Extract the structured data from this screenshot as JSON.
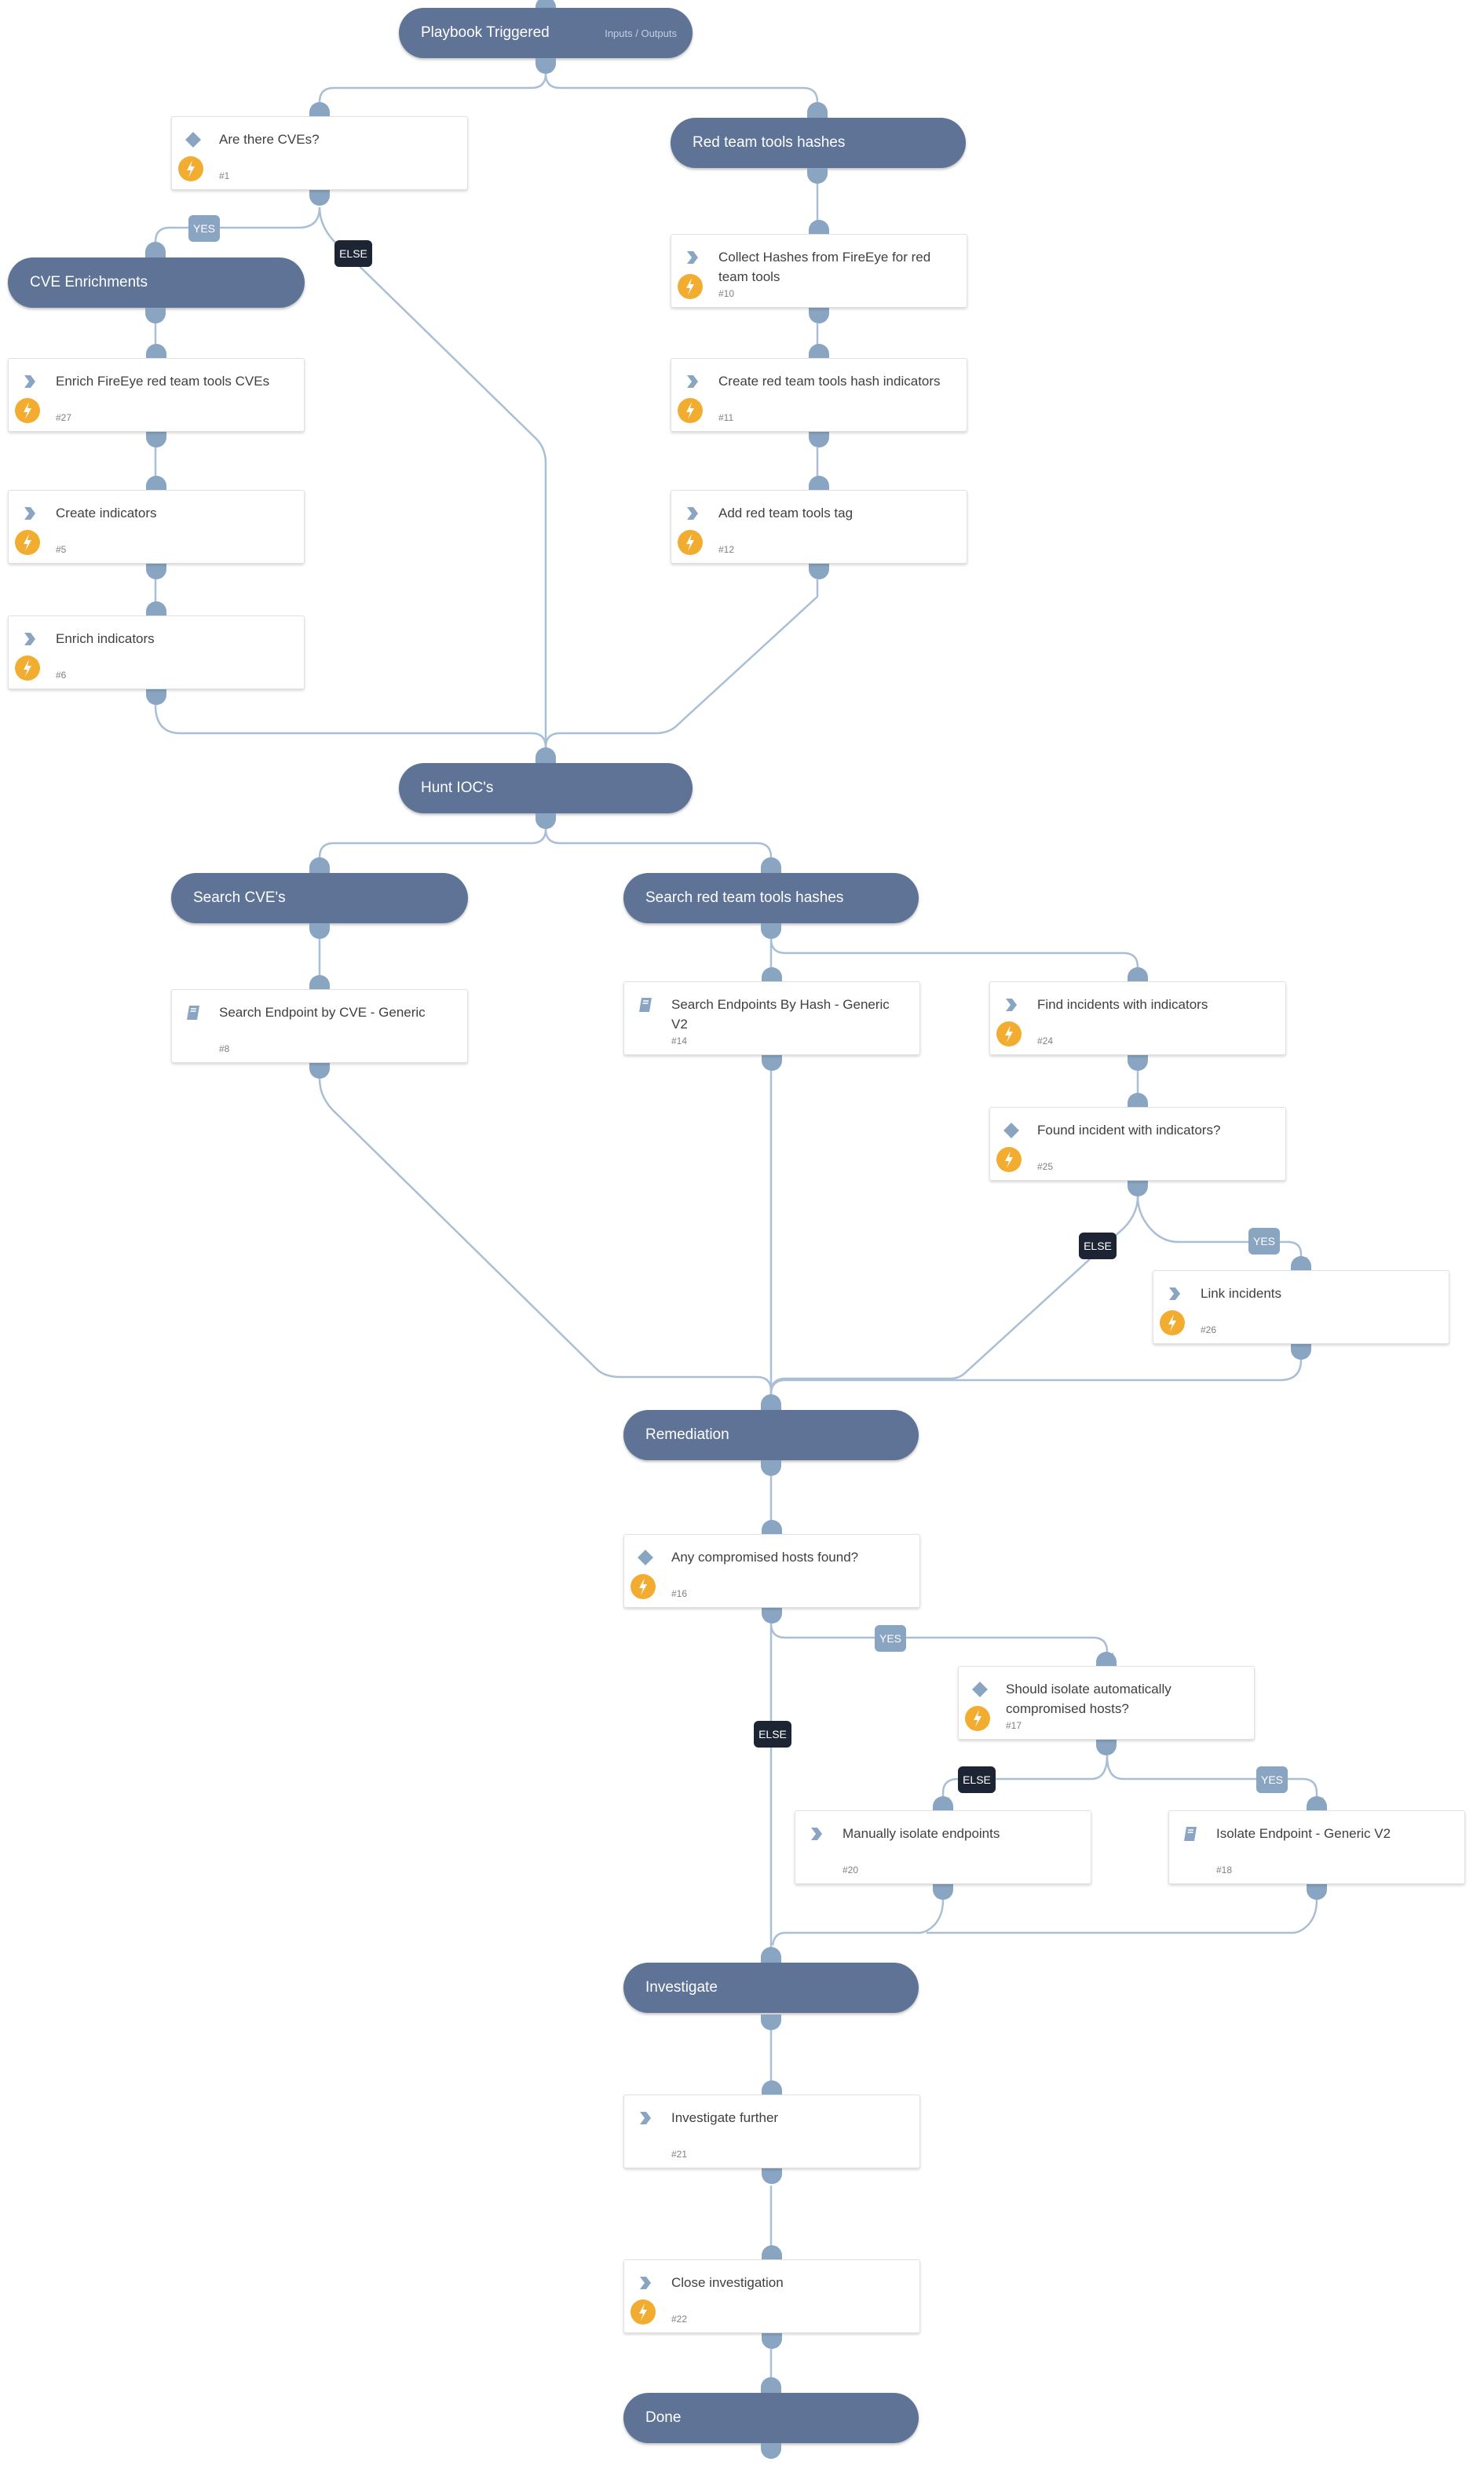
{
  "colors": {
    "section_bg": "#5f7396",
    "edge": "#a9bfd6",
    "port": "#8aa5c2",
    "bolt": "#f2ad30",
    "yes_label": "#8aa5c2",
    "else_label": "#1d2433"
  },
  "start": {
    "title": "Playbook Triggered",
    "io_link": "Inputs / Outputs"
  },
  "sections": {
    "cve_enrichments": "CVE Enrichments",
    "red_team_hashes": "Red team tools hashes",
    "hunt_iocs": "Hunt IOC's",
    "search_cves": "Search CVE's",
    "search_red_team_hashes": "Search red team tools hashes",
    "remediation": "Remediation",
    "investigate": "Investigate",
    "done": "Done"
  },
  "tasks": {
    "t1": {
      "title": "Are there CVEs?",
      "id": "#1",
      "type": "condition",
      "icon": "diamond-icon",
      "automated": true
    },
    "t27": {
      "title": "Enrich FireEye red team tools CVEs",
      "id": "#27",
      "type": "task",
      "icon": "chevron-icon",
      "automated": true
    },
    "t5": {
      "title": "Create indicators",
      "id": "#5",
      "type": "task",
      "icon": "chevron-icon",
      "automated": true
    },
    "t6": {
      "title": "Enrich indicators",
      "id": "#6",
      "type": "task",
      "icon": "chevron-icon",
      "automated": true
    },
    "t10": {
      "title": "Collect Hashes from FireEye for red team tools",
      "id": "#10",
      "type": "task",
      "icon": "chevron-icon",
      "automated": true
    },
    "t11": {
      "title": "Create red team tools hash indicators",
      "id": "#11",
      "type": "task",
      "icon": "chevron-icon",
      "automated": true
    },
    "t12": {
      "title": "Add red team tools tag",
      "id": "#12",
      "type": "task",
      "icon": "chevron-icon",
      "automated": true
    },
    "t8": {
      "title": "Search Endpoint by CVE - Generic",
      "id": "#8",
      "type": "playbook",
      "icon": "book-icon",
      "automated": false
    },
    "t14": {
      "title": "Search Endpoints By Hash - Generic V2",
      "id": "#14",
      "type": "playbook",
      "icon": "book-icon",
      "automated": false
    },
    "t24": {
      "title": "Find incidents with indicators",
      "id": "#24",
      "type": "task",
      "icon": "chevron-icon",
      "automated": true
    },
    "t25": {
      "title": "Found incident with indicators?",
      "id": "#25",
      "type": "condition",
      "icon": "diamond-icon",
      "automated": true
    },
    "t26": {
      "title": "Link incidents",
      "id": "#26",
      "type": "task",
      "icon": "chevron-icon",
      "automated": true
    },
    "t16": {
      "title": "Any compromised hosts found?",
      "id": "#16",
      "type": "condition",
      "icon": "diamond-icon",
      "automated": true
    },
    "t17": {
      "title": "Should isolate automatically compromised hosts?",
      "id": "#17",
      "type": "condition",
      "icon": "diamond-icon",
      "automated": true
    },
    "t20": {
      "title": "Manually isolate endpoints",
      "id": "#20",
      "type": "task",
      "icon": "chevron-icon",
      "automated": false
    },
    "t18": {
      "title": "Isolate Endpoint - Generic V2",
      "id": "#18",
      "type": "playbook",
      "icon": "book-icon",
      "automated": false
    },
    "t21": {
      "title": "Investigate further",
      "id": "#21",
      "type": "task",
      "icon": "chevron-icon",
      "automated": false
    },
    "t22": {
      "title": "Close investigation",
      "id": "#22",
      "type": "task",
      "icon": "chevron-icon",
      "automated": true
    }
  },
  "edge_labels": {
    "yes": "YES",
    "else": "ELSE"
  }
}
